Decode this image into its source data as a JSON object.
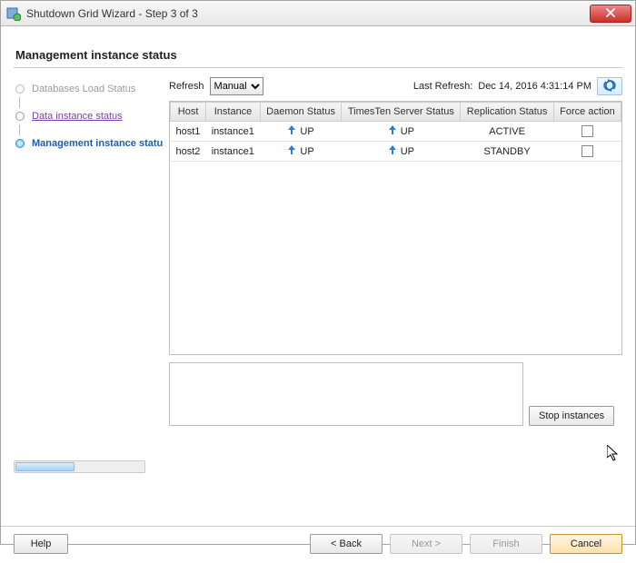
{
  "window": {
    "title": "Shutdown Grid Wizard - Step 3 of 3"
  },
  "header": {
    "section_title": "Management instance status"
  },
  "sidebar": {
    "steps": [
      {
        "label": "Databases Load Status"
      },
      {
        "label": "Data instance status"
      },
      {
        "label": "Management instance status"
      }
    ]
  },
  "refresh": {
    "label": "Refresh",
    "mode": "Manual",
    "last_label": "Last Refresh:",
    "last_value": "Dec 14, 2016 4:31:14 PM"
  },
  "table": {
    "columns": {
      "host": "Host",
      "instance": "Instance",
      "daemon": "Daemon Status",
      "server": "TimesTen Server Status",
      "replication": "Replication Status",
      "force": "Force action"
    },
    "up_label": "UP",
    "rows": [
      {
        "host": "host1",
        "instance": "instance1",
        "daemon": "UP",
        "server": "UP",
        "replication": "ACTIVE",
        "force": false
      },
      {
        "host": "host2",
        "instance": "instance1",
        "daemon": "UP",
        "server": "UP",
        "replication": "STANDBY",
        "force": false
      }
    ]
  },
  "buttons": {
    "stop_instances": "Stop instances",
    "help": "Help",
    "back": "< Back",
    "next": "Next >",
    "finish": "Finish",
    "cancel": "Cancel"
  }
}
